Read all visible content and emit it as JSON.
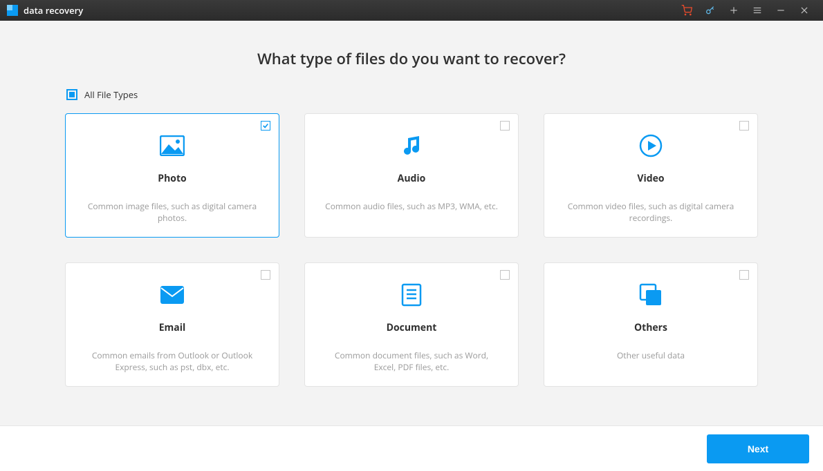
{
  "app": {
    "title": "data recovery"
  },
  "heading": "What type of files do you want to recover?",
  "all_files": {
    "label": "All File Types"
  },
  "cards": [
    {
      "title": "Photo",
      "desc": "Common image files, such as digital camera photos.",
      "selected": true
    },
    {
      "title": "Audio",
      "desc": "Common audio files, such as MP3, WMA, etc.",
      "selected": false
    },
    {
      "title": "Video",
      "desc": "Common video files, such as digital camera recordings.",
      "selected": false
    },
    {
      "title": "Email",
      "desc": "Common emails from Outlook or Outlook Express, such as pst, dbx, etc.",
      "selected": false
    },
    {
      "title": "Document",
      "desc": "Common document files, such as Word, Excel, PDF files, etc.",
      "selected": false
    },
    {
      "title": "Others",
      "desc": "Other useful data",
      "selected": false
    }
  ],
  "footer": {
    "next": "Next"
  },
  "accent": "#0a9af2"
}
